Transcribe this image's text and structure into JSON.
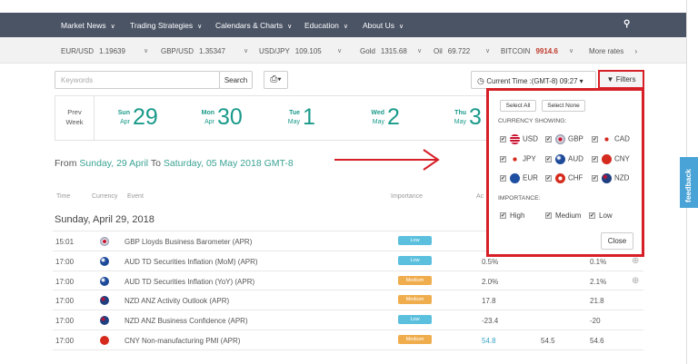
{
  "nav": {
    "items": [
      "Market News",
      "Trading Strategies",
      "Calendars & Charts",
      "Education",
      "About Us"
    ],
    "search_icon": "search-icon"
  },
  "ticker": [
    {
      "name": "EUR/USD",
      "value": "1.19639"
    },
    {
      "name": "GBP/USD",
      "value": "1.35347"
    },
    {
      "name": "USD/JPY",
      "value": "109.105"
    },
    {
      "name": "Gold",
      "value": "1315.68"
    },
    {
      "name": "Oil",
      "value": "69.722"
    },
    {
      "name": "BITCOIN",
      "value": "9914.6"
    }
  ],
  "more_rates": "More rates",
  "colors": {
    "nav": "#4b5465",
    "accent": "#1a9a8a",
    "highlight": "#d61f26",
    "low": "#5bc0de",
    "medium": "#f0ad4e",
    "bitcoin": "#c0392b"
  },
  "toolbar": {
    "search_placeholder": "Keywords",
    "search_label": "Search",
    "time_label": "Current Time :(GMT-8) 09:27",
    "filters_label": "Filters"
  },
  "week": {
    "prev": "Prev",
    "prev2": "Week",
    "days": [
      {
        "dow": "Sun",
        "mon": "Apr",
        "num": "29"
      },
      {
        "dow": "Mon",
        "mon": "Apr",
        "num": "30"
      },
      {
        "dow": "Tue",
        "mon": "May",
        "num": "1"
      },
      {
        "dow": "Wed",
        "mon": "May",
        "num": "2"
      },
      {
        "dow": "Thu",
        "mon": "May",
        "num": "3"
      }
    ]
  },
  "range": {
    "from": "From",
    "start": "Sunday, 29 April",
    "to": "To",
    "end": "Saturday, 05 May 2018 GMT-8"
  },
  "table": {
    "headers": {
      "time": "Time",
      "currency": "Currency",
      "event": "Event",
      "importance": "Importance",
      "actual": "Ac"
    },
    "day": "Sunday, April 29, 2018",
    "rows": [
      {
        "time": "15:01",
        "cur": "GBP",
        "event": "GBP Lloyds Business Barometer (APR)",
        "imp": "Low",
        "actual": "",
        "forecast": "",
        "previous": "",
        "plus": false
      },
      {
        "time": "17:00",
        "cur": "AUD",
        "event": "AUD TD Securities Inflation (MoM) (APR)",
        "imp": "Low",
        "actual": "0.5%",
        "forecast": "",
        "previous": "0.1%",
        "plus": true
      },
      {
        "time": "17:00",
        "cur": "AUD",
        "event": "AUD TD Securities Inflation (YoY) (APR)",
        "imp": "Medium",
        "actual": "2.0%",
        "forecast": "",
        "previous": "2.1%",
        "plus": true
      },
      {
        "time": "17:00",
        "cur": "NZD",
        "event": "NZD ANZ Activity Outlook (APR)",
        "imp": "Medium",
        "actual": "17.8",
        "forecast": "",
        "previous": "21.8",
        "plus": false
      },
      {
        "time": "17:00",
        "cur": "NZD",
        "event": "NZD ANZ Business Confidence (APR)",
        "imp": "Low",
        "actual": "-23.4",
        "forecast": "",
        "previous": "-20",
        "plus": false
      },
      {
        "time": "17:00",
        "cur": "CNY",
        "event": "CNY Non-manufacturing PMI (APR)",
        "imp": "Medium",
        "actual": "54.8",
        "forecast": "54.5",
        "previous": "54.6",
        "plus": false
      }
    ]
  },
  "filters": {
    "select_all": "Select All",
    "select_none": "Select None",
    "currency_label": "CURRENCY SHOWING:",
    "currencies": [
      "USD",
      "GBP",
      "CAD",
      "JPY",
      "AUD",
      "CNY",
      "EUR",
      "CHF",
      "NZD"
    ],
    "importance_label": "IMPORTANCE:",
    "importance": [
      "High",
      "Medium",
      "Low"
    ],
    "close": "Close"
  },
  "feedback": "feedback"
}
